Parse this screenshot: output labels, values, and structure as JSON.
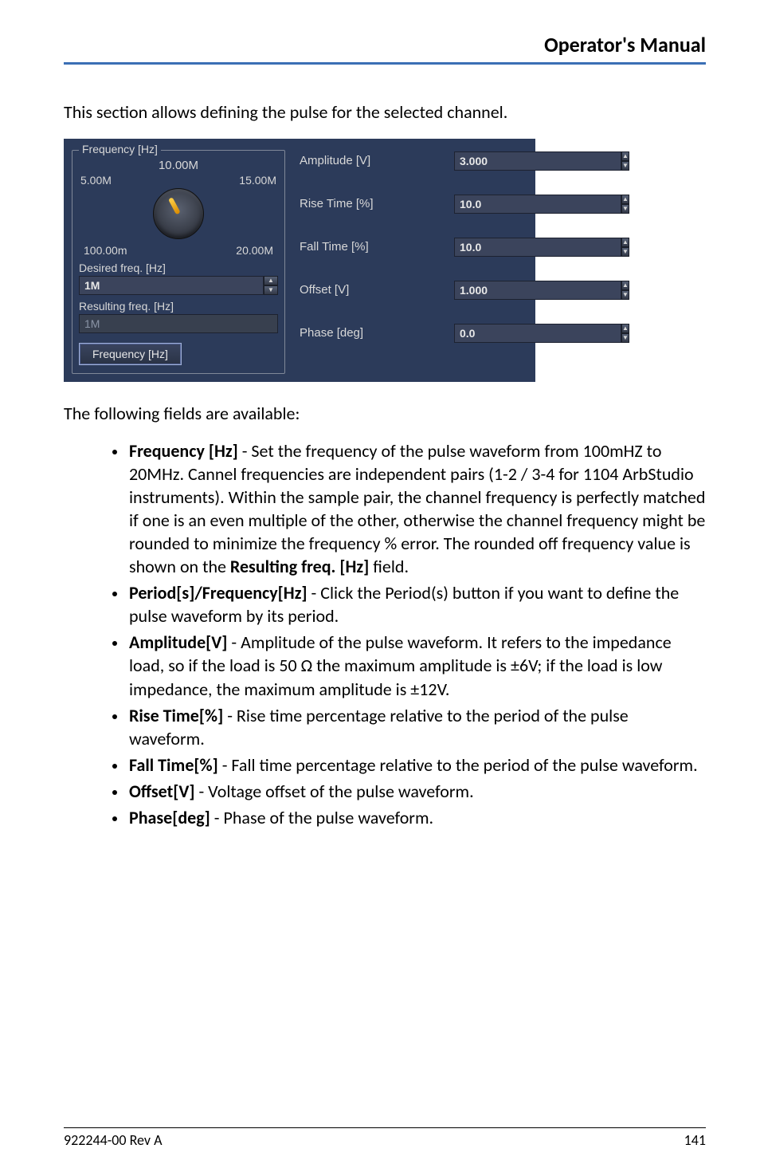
{
  "header": {
    "title": "Operator's Manual"
  },
  "intro": "This section allows defining the pulse for the selected channel.",
  "panel": {
    "freq": {
      "legend": "Frequency [Hz]",
      "dial_top": "10.00M",
      "dial_min": "5.00M",
      "dial_max": "15.00M",
      "scale_min": "100.00m",
      "scale_max": "20.00M",
      "desired_label": "Desired freq. [Hz]",
      "desired_value": "1M",
      "resulting_label": "Resulting freq. [Hz]",
      "resulting_value": "1M",
      "toggle_label": "Frequency [Hz]"
    },
    "params": {
      "amplitude_label": "Amplitude [V]",
      "amplitude_value": "3.000",
      "rise_label": "Rise Time [%]",
      "rise_value": "10.0",
      "fall_label": "Fall Time [%]",
      "fall_value": "10.0",
      "offset_label": "Offset [V]",
      "offset_value": "1.000",
      "phase_label": "Phase [deg]",
      "phase_value": "0.0"
    }
  },
  "following": "The following fields are available:",
  "bullets": {
    "freq_b": "Frequency [Hz]",
    "freq_t": " - Set the frequency of the pulse waveform from 100mHZ to 20MHz. Cannel frequencies are independent pairs (1-2 / 3-4 for 1104 ArbStudio instruments). Within the sample pair, the channel frequency is perfectly matched if one is an even multiple of the other, otherwise the channel frequency might be rounded to minimize the frequency % error. The rounded off frequency value is shown on the ",
    "freq_b2": "Resulting freq. [Hz]",
    "freq_t2": " field.",
    "period_b": "Period[s]/Frequency[Hz]",
    "period_t": " - Click the Period(s) button if you want to define the pulse waveform by its period.",
    "amp_b": "Amplitude[V]",
    "amp_t": " - Amplitude of the pulse waveform. It refers to the impedance load, so if the load is 50 Ω the maximum amplitude is ±6V; if the load is low impedance, the maximum amplitude is ±12V.",
    "rise_b": "Rise Time[%]",
    "rise_t": " - Rise time percentage relative to the period of the pulse waveform.",
    "fall_b": "Fall Time[%]",
    "fall_t": " - Fall time percentage relative to the period of the pulse waveform.",
    "off_b": "Offset[V]",
    "off_t": " - Voltage offset of the pulse waveform.",
    "phase_b": "Phase[deg]",
    "phase_t": " - Phase of the pulse waveform."
  },
  "footer": {
    "rev": "922244-00 Rev A",
    "page": "141"
  }
}
